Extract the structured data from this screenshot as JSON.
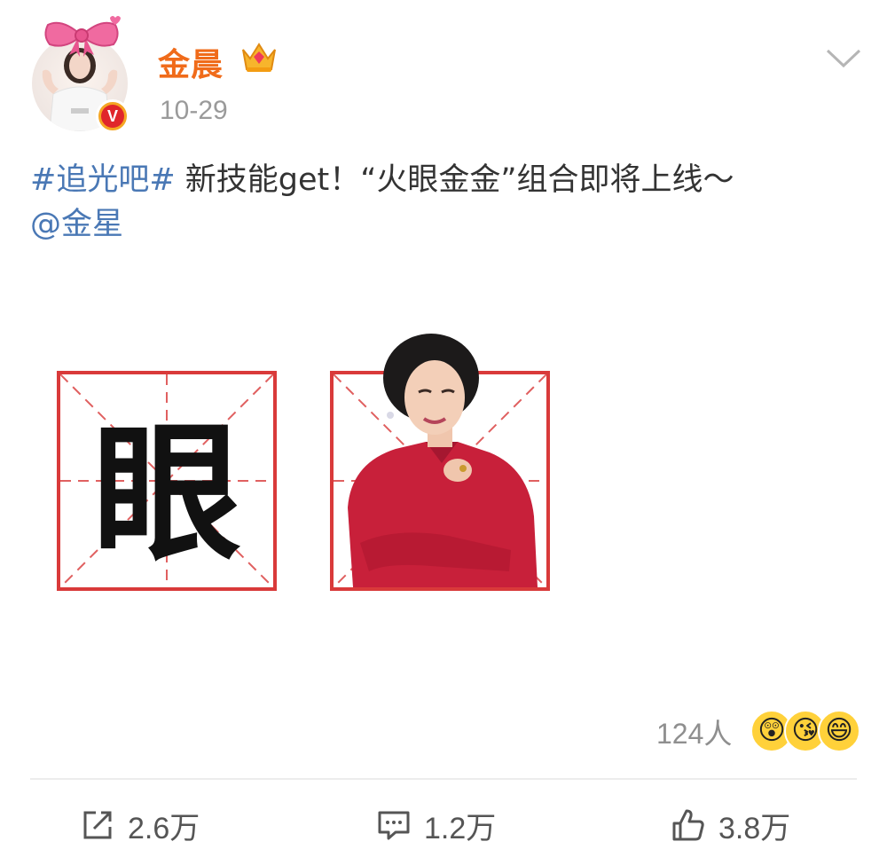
{
  "post": {
    "username": "金晨",
    "date": "10-29",
    "verified_badge": "V",
    "text": {
      "hashtag": "#追光吧#",
      "body": "新技能get！“火眼金金”组合即将上线～",
      "mention": "@金星"
    },
    "images": [
      {
        "type": "character-grid",
        "character": "眼"
      },
      {
        "type": "person-cutout",
        "icon": "woman-in-red-qipao"
      }
    ],
    "reactions": {
      "count": "124人",
      "emojis": [
        "😲",
        "😘",
        "😄"
      ]
    },
    "actions": {
      "share": "2.6万",
      "comment": "1.2万",
      "like": "3.8万"
    }
  },
  "icons": {
    "more": "chevron-down-icon",
    "crown": "crown-icon",
    "share": "share-icon",
    "comment": "comment-icon",
    "like": "thumbs-up-icon"
  },
  "colors": {
    "username": "#f06b1a",
    "link": "#4a78b5",
    "grid_red": "#d93a3a",
    "qipao_red": "#c8203a"
  }
}
